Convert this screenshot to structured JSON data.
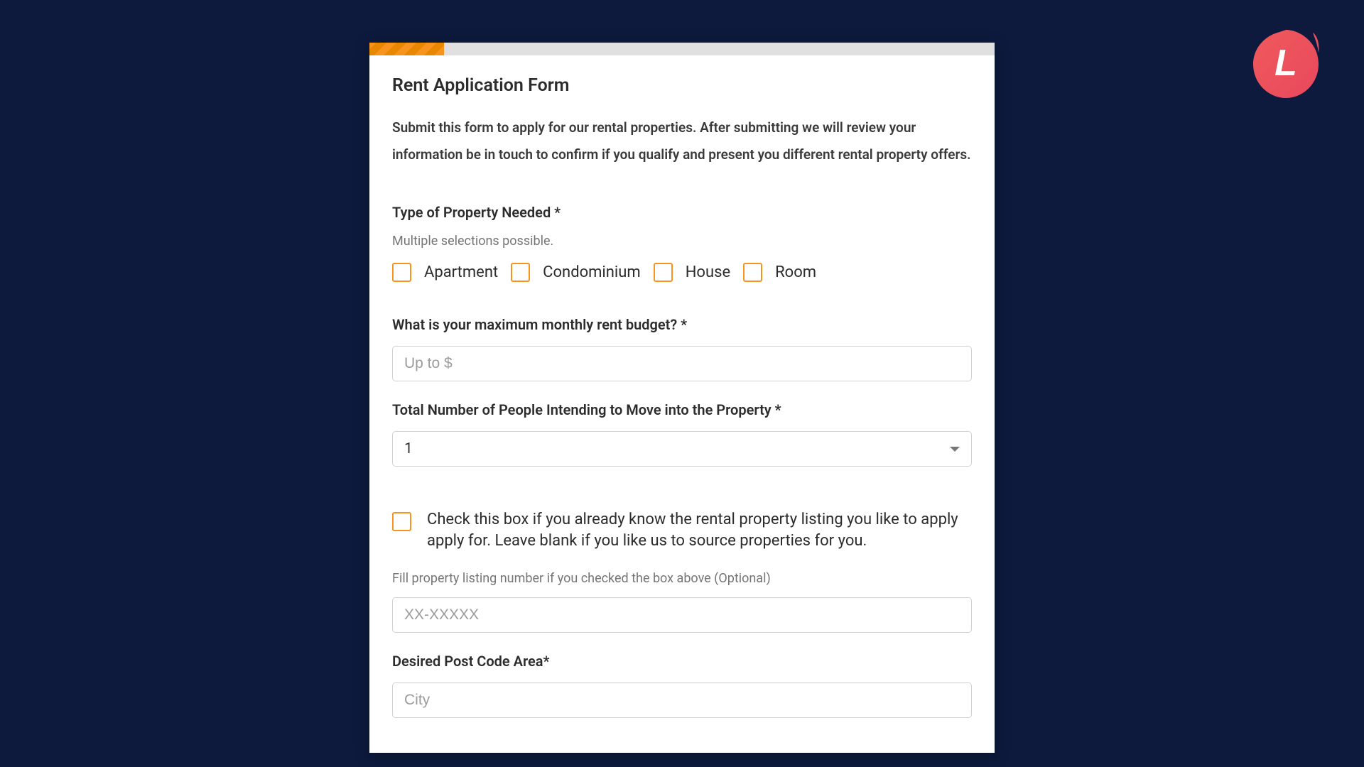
{
  "logo": {
    "letter": "L"
  },
  "form": {
    "title": "Rent Application Form",
    "subtitle": "Submit this form to apply for our rental properties. After submitting we will review your information be in touch to confirm if you qualify and present you different rental property offers.",
    "property_type": {
      "label": "Type of Property Needed *",
      "helper": "Multiple selections possible.",
      "options": [
        "Apartment",
        "Condominium",
        "House",
        "Room"
      ]
    },
    "budget": {
      "label": "What is your maximum monthly rent budget? *",
      "placeholder": "Up to $"
    },
    "people_count": {
      "label": "Total Number of People Intending to Move into the Property *",
      "value": "1"
    },
    "known_listing": {
      "label": "Check this box if you already know the rental property listing you like to apply apply for. Leave blank if you like us to source properties for you."
    },
    "listing_number": {
      "label": "Fill property listing number if you checked the box above (Optional)",
      "placeholder": "XX-XXXXX"
    },
    "postcode": {
      "label": "Desired Post Code Area*",
      "placeholder": "City"
    }
  }
}
